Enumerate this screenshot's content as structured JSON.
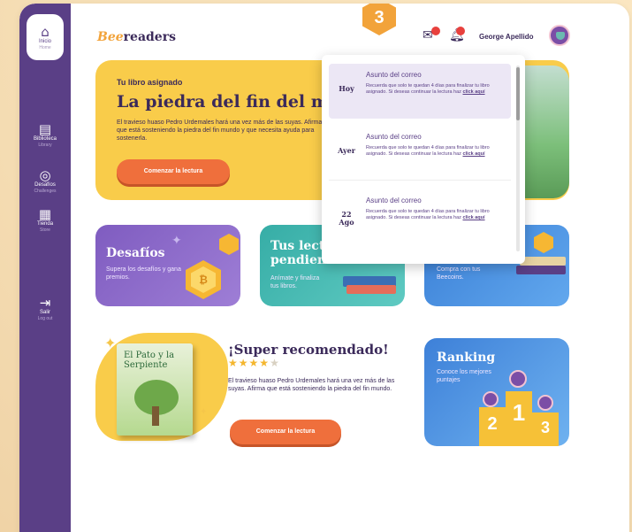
{
  "step_badge": "3",
  "sidebar": {
    "items": [
      {
        "icon": "home-icon",
        "glyph": "⌂",
        "label": "Inicio",
        "sub": "Home"
      },
      {
        "icon": "book-icon",
        "glyph": "▤",
        "label": "Biblioteca",
        "sub": "Library"
      },
      {
        "icon": "target-icon",
        "glyph": "◎",
        "label": "Desafíos",
        "sub": "Challenges"
      },
      {
        "icon": "store-icon",
        "glyph": "▦",
        "label": "Tienda",
        "sub": "Store"
      },
      {
        "icon": "logout-icon",
        "glyph": "⇥",
        "label": "Salir",
        "sub": "Log out"
      }
    ]
  },
  "header": {
    "logo_b": "Bee",
    "logo_rest": "readers",
    "mail_icon": "mail-icon",
    "bell_icon": "bell-icon",
    "user_name": "George Apellido"
  },
  "hero": {
    "subtitle": "Tu libro asignado",
    "title": "La piedra del fin del mundo",
    "description": "El travieso huaso Pedro Urdemales hará una vez más de las suyas. Afirma que está sosteniendo la piedra del fin mundo y que necesita ayuda para sostenerla.",
    "button": "Comenzar la lectura"
  },
  "cards": {
    "challenges": {
      "title": "Desafíos",
      "desc": "Supera los desafíos y gana premios."
    },
    "pending": {
      "title": "Tus lecturas pendientes",
      "desc": "Anímate y finaliza tus libros."
    },
    "store": {
      "desc": "Compra con tus Beecoins."
    }
  },
  "recommended": {
    "heading": "¡Super recomendado!",
    "book_title": "El Pato y la Serpiente",
    "rating": 4,
    "max_rating": 5,
    "description": "El travieso huaso Pedro Urdemales hará una vez más de las suyas. Afirma que está sosteniendo la piedra del fin mundo.",
    "button": "Comenzar la lectura"
  },
  "ranking": {
    "title": "Ranking",
    "desc": "Conoce los mejores puntajes",
    "places": [
      "2",
      "1",
      "3"
    ]
  },
  "notifications": [
    {
      "date": "Hoy",
      "subject": "Asunto del correo",
      "body": "Recuerda que solo te quedan 4 días para finalizar tu libro asignado. Si deseas continuar la lectura haz",
      "link": "click aquí"
    },
    {
      "date": "Ayer",
      "subject": "Asunto del correo",
      "body": "Recuerda que solo te quedan 4 días para finalizar tu libro asignado. Si deseas continuar la lectura haz",
      "link": "click aquí"
    },
    {
      "date": "22 Ago",
      "subject": "Asunto del correo",
      "body": "Recuerda que solo te quedan 4 días para finalizar tu libro asignado. Si deseas continuar la lectura haz",
      "link": "click aquí"
    }
  ],
  "colors": {
    "sidebar": "#5a3f86",
    "accent_yellow": "#f9cc4a",
    "accent_orange": "#ef6f3c",
    "purple_card": "#8a6cc4",
    "teal_card": "#3fb7b0",
    "blue_card": "#3d80d8"
  }
}
